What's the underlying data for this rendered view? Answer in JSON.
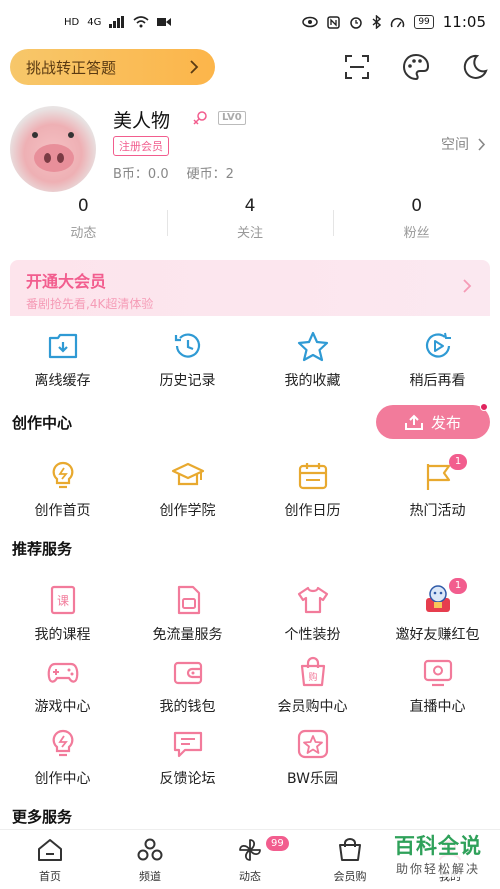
{
  "status_bar": {
    "left": [
      "HD",
      "4G"
    ],
    "battery": "99",
    "time": "11:05"
  },
  "top": {
    "challenge_label": "挑战转正答题",
    "icons": [
      "scan-icon",
      "palette-icon",
      "moon-icon"
    ]
  },
  "profile": {
    "name": "美人物",
    "level": "LV0",
    "member_badge": "注册会员",
    "b_coin": "B币：0.0",
    "hard_coin": "硬币：2",
    "space_label": "空间"
  },
  "stats": [
    {
      "value": "0",
      "label": "动态"
    },
    {
      "value": "4",
      "label": "关注"
    },
    {
      "value": "0",
      "label": "粉丝"
    }
  ],
  "vip_banner": {
    "title": "开通大会员",
    "subtitle": "番剧抢先看,4K超清体验"
  },
  "quick_actions": [
    {
      "label": "离线缓存",
      "icon": "download-icon"
    },
    {
      "label": "历史记录",
      "icon": "history-icon"
    },
    {
      "label": "我的收藏",
      "icon": "star-icon"
    },
    {
      "label": "稍后再看",
      "icon": "play-later-icon"
    }
  ],
  "creation": {
    "title": "创作中心",
    "publish_label": "发布",
    "items": [
      {
        "label": "创作首页",
        "icon": "bulb-icon",
        "badge": ""
      },
      {
        "label": "创作学院",
        "icon": "graduation-icon",
        "badge": ""
      },
      {
        "label": "创作日历",
        "icon": "calendar-icon",
        "badge": ""
      },
      {
        "label": "热门活动",
        "icon": "flag-icon",
        "badge": "1"
      }
    ]
  },
  "recommended": {
    "title": "推荐服务",
    "rows": [
      [
        {
          "label": "我的课程",
          "icon": "course-icon",
          "badge": ""
        },
        {
          "label": "免流量服务",
          "icon": "sim-card-icon",
          "badge": ""
        },
        {
          "label": "个性装扮",
          "icon": "tshirt-icon",
          "badge": ""
        },
        {
          "label": "邀好友赚红包",
          "icon": "invite-gift-icon",
          "badge": "1"
        }
      ],
      [
        {
          "label": "游戏中心",
          "icon": "gamepad-icon",
          "badge": ""
        },
        {
          "label": "我的钱包",
          "icon": "wallet-icon",
          "badge": ""
        },
        {
          "label": "会员购中心",
          "icon": "shopping-bag-icon",
          "badge": ""
        },
        {
          "label": "直播中心",
          "icon": "live-tv-icon",
          "badge": ""
        }
      ],
      [
        {
          "label": "创作中心",
          "icon": "bulb-icon",
          "badge": ""
        },
        {
          "label": "反馈论坛",
          "icon": "feedback-icon",
          "badge": ""
        },
        {
          "label": "BW乐园",
          "icon": "bw-star-icon",
          "badge": ""
        }
      ]
    ]
  },
  "more": {
    "title": "更多服务"
  },
  "tabbar": [
    {
      "label": "首页",
      "icon": "home-icon",
      "badge": ""
    },
    {
      "label": "频道",
      "icon": "channel-icon",
      "badge": ""
    },
    {
      "label": "动态",
      "icon": "pinwheel-icon",
      "badge": "99"
    },
    {
      "label": "会员购",
      "icon": "shop-icon",
      "badge": ""
    },
    {
      "label": "我的",
      "icon": "user-icon",
      "badge": ""
    }
  ],
  "watermark": {
    "title": "百科全说",
    "subtitle": "助你轻松解决"
  },
  "colors": {
    "accent": "#f25d8e",
    "icon_blue": "#2f9ad4",
    "icon_gold": "#e8a92f",
    "icon_pink": "#f27b9b"
  }
}
